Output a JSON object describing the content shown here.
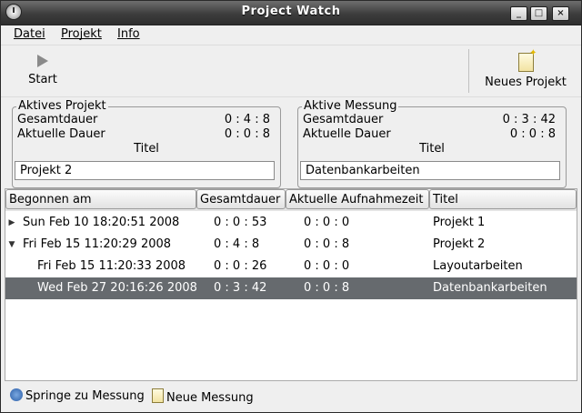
{
  "window": {
    "title": "Project Watch"
  },
  "menu": [
    {
      "label": "Datei"
    },
    {
      "label": "Projekt"
    },
    {
      "label": "Info"
    }
  ],
  "toolbar": {
    "start_label": "Start",
    "new_project_label": "Neues Projekt"
  },
  "active_project": {
    "legend": "Aktives Projekt",
    "total_label": "Gesamtdauer",
    "total_value": "0 : 4 : 8",
    "current_label": "Aktuelle Dauer",
    "current_value": "0 : 0 : 8",
    "title_label": "Titel",
    "title_value": "Projekt 2"
  },
  "active_measurement": {
    "legend": "Aktive Messung",
    "total_label": "Gesamtdauer",
    "total_value": "0 : 3 : 42",
    "current_label": "Aktuelle Dauer",
    "current_value": "0 : 0 : 8",
    "title_label": "Titel",
    "title_value": "Datenbankarbeiten"
  },
  "table": {
    "columns": [
      "Begonnen am",
      "Gesamtdauer",
      "Aktuelle Aufnahmezeit",
      "Titel"
    ],
    "rows": [
      {
        "started": "Sun Feb 10 18:20:51 2008",
        "total": "0 : 0 : 53",
        "current": "0 : 0 : 0",
        "title": "Projekt 1"
      },
      {
        "started": "Fri Feb 15 11:20:29 2008",
        "total": "0 : 4 : 8",
        "current": "0 : 0 : 8",
        "title": "Projekt 2"
      },
      {
        "started": "Fri Feb 15 11:20:33 2008",
        "total": "0 : 0 : 26",
        "current": "0 : 0 : 0",
        "title": "Layoutarbeiten"
      },
      {
        "started": "Wed Feb 27 20:16:26 2008",
        "total": "0 : 3 : 42",
        "current": "0 : 0 : 8",
        "title": "Datenbankarbeiten"
      }
    ]
  },
  "statusbar": {
    "jump_label": "Springe zu Messung",
    "new_measurement_label": "Neue Messung"
  }
}
